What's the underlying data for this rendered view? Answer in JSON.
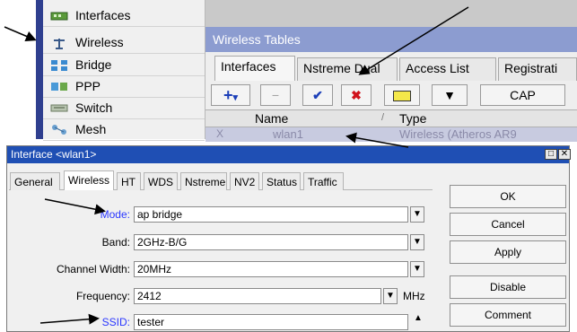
{
  "nav": {
    "items": [
      {
        "label": "Interfaces"
      },
      {
        "label": "Wireless"
      },
      {
        "label": "Bridge"
      },
      {
        "label": "PPP"
      },
      {
        "label": "Switch"
      },
      {
        "label": "Mesh"
      }
    ]
  },
  "wireless_tables": {
    "title": "Wireless Tables",
    "tabs": [
      "Interfaces",
      "Nstreme Dual",
      "Access List",
      "Registrati"
    ],
    "toolbar": {
      "add": "+",
      "dropdown": "▾",
      "remove": "−",
      "enable": "✔",
      "disable": "✖",
      "comment": "▭",
      "filter": "▼",
      "cap_label": "CAP"
    },
    "columns": {
      "name": "Name",
      "sort": "/",
      "type": "Type"
    },
    "row": {
      "flag": "X",
      "name": "wlan1",
      "type": "Wireless (Atheros AR9"
    }
  },
  "dialog": {
    "title": "Interface <wlan1>",
    "controls": {
      "restore": "□",
      "close": "✕"
    },
    "tabs": [
      "General",
      "Wireless",
      "HT",
      "WDS",
      "Nstreme",
      "NV2",
      "Status",
      "Traffic"
    ],
    "fields": {
      "mode": {
        "label": "Mode:",
        "value": "ap bridge"
      },
      "band": {
        "label": "Band:",
        "value": "2GHz-B/G"
      },
      "channel_width": {
        "label": "Channel Width:",
        "value": "20MHz"
      },
      "frequency": {
        "label": "Frequency:",
        "value": "2412",
        "unit": "MHz"
      },
      "ssid": {
        "label": "SSID:",
        "value": "tester"
      }
    },
    "buttons": {
      "ok": "OK",
      "cancel": "Cancel",
      "apply": "Apply",
      "disable": "Disable",
      "comment": "Comment"
    }
  },
  "colors": {
    "nav_bar": "#2f3f8f",
    "wt_title": "#8c9cd0",
    "dialog_title": "#1f4fb4",
    "label_highlight": "#2a37ff",
    "remove_red": "#d0121b",
    "check_blue": "#1c3fb8"
  }
}
